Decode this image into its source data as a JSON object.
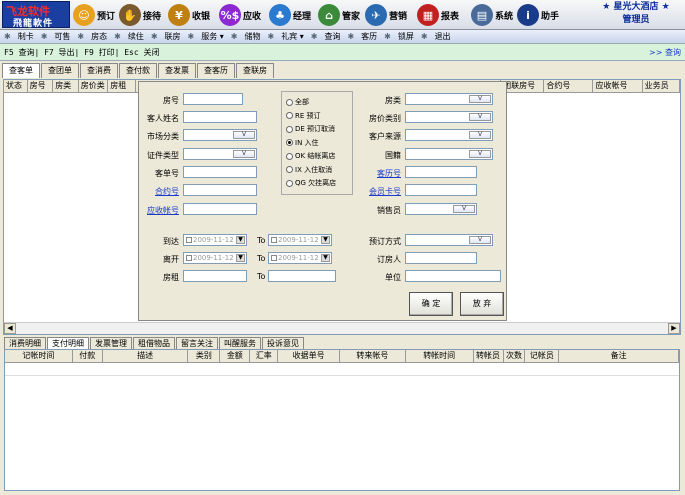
{
  "app": {
    "logo_text": "飞龙软件",
    "logo_text2": "飛龍軟件",
    "hotel_name": "星光大酒店",
    "user_role": "管理员"
  },
  "toolbar": [
    {
      "label": "预订",
      "icon": "booking-icon",
      "color": "#e8a020"
    },
    {
      "label": "接待",
      "icon": "reception-icon",
      "color": "#7a5a2a"
    },
    {
      "label": "收银",
      "icon": "cashier-icon",
      "color": "#c08010"
    },
    {
      "label": "应收",
      "icon": "receivable-icon",
      "color": "#8a2ad0"
    },
    {
      "label": "经理",
      "icon": "manager-icon",
      "color": "#2a7ad0"
    },
    {
      "label": "管家",
      "icon": "housekeeper-icon",
      "color": "#3a8a3a"
    },
    {
      "label": "营销",
      "icon": "marketing-icon",
      "color": "#2a6ab0"
    },
    {
      "label": "报表",
      "icon": "report-icon",
      "color": "#c02020"
    },
    {
      "label": "系统",
      "icon": "system-icon",
      "color": "#4a6a9a"
    },
    {
      "label": "助手",
      "icon": "help-icon",
      "color": "#1a3a8a"
    }
  ],
  "menubar": [
    "制卡",
    "可售",
    "房态",
    "续住",
    "联房",
    "服务 ▾",
    "储物",
    "礼宾 ▾",
    "查询",
    "客历",
    "锁屏",
    "退出"
  ],
  "shortcuts": "F5 查询| F7 导出| F9 打印| Esc 关闭",
  "query_link": ">> 查询",
  "tabs": [
    {
      "label": "查客单",
      "active": true
    },
    {
      "label": "查团单",
      "active": false
    },
    {
      "label": "查消费",
      "active": false
    },
    {
      "label": "查付款",
      "active": false
    },
    {
      "label": "查发票",
      "active": false
    },
    {
      "label": "查客历",
      "active": false
    },
    {
      "label": "查联房",
      "active": false
    }
  ],
  "grid_headers_left": [
    "状态",
    "房号",
    "房类",
    "房价类",
    "房租"
  ],
  "grid_headers_right": [
    "团联房号",
    "合约号",
    "应收帐号",
    "业务员"
  ],
  "form": {
    "room_no": "房号",
    "guest_name": "客人姓名",
    "market": "市场分类",
    "id_type": "证件类型",
    "order_no": "客单号",
    "contract_no": "合约号",
    "ar_account": "应收帐号",
    "room_type": "房类",
    "rate_type": "房价类别",
    "source": "客户来源",
    "nationality": "国籍",
    "history_no": "客历号",
    "member_card": "会员卡号",
    "salesman": "销售员",
    "arrival": "到达",
    "departure": "离开",
    "rent": "房租",
    "to": "To",
    "booking_method": "预订方式",
    "booker": "订房人",
    "company": "单位",
    "date_from": "2009-11-12",
    "date_to": "2009-11-12",
    "radios": [
      {
        "label": "全部",
        "checked": false
      },
      {
        "label": "RE 预订",
        "checked": false
      },
      {
        "label": "DE 预订取消",
        "checked": false
      },
      {
        "label": "IN 入住",
        "checked": true
      },
      {
        "label": "OK 结帐离店",
        "checked": false
      },
      {
        "label": "IX 入住取消",
        "checked": false
      },
      {
        "label": "QG 欠挂离店",
        "checked": false
      }
    ],
    "confirm": "确 定",
    "cancel": "放 弃"
  },
  "bottom_tabs": [
    {
      "label": "消费明细",
      "active": false
    },
    {
      "label": "支付明细",
      "active": true
    },
    {
      "label": "发票管理",
      "active": false
    },
    {
      "label": "租借物品",
      "active": false
    },
    {
      "label": "留言关注",
      "active": false
    },
    {
      "label": "叫醒服务",
      "active": false
    },
    {
      "label": "投诉意见",
      "active": false
    }
  ],
  "bottom_headers": [
    "记帐时间",
    "付款",
    "描述",
    "类别",
    "金额",
    "汇率",
    "收据单号",
    "转来帐号",
    "转帐时间",
    "转帐员",
    "次数",
    "记帐员",
    "备注"
  ]
}
